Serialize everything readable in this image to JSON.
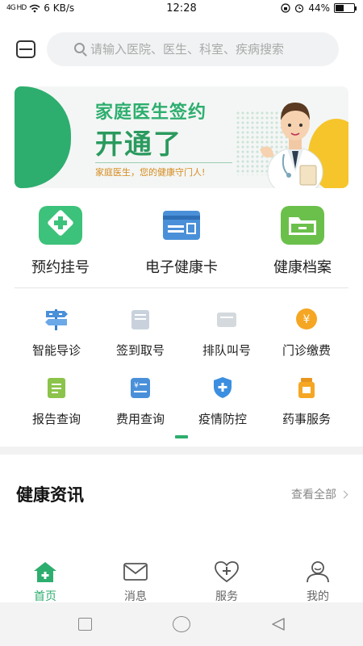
{
  "status": {
    "signal": "4G HD",
    "speed": "6 KB/s",
    "time": "12:28",
    "battery_text": "44%",
    "battery_level": 0.44
  },
  "search": {
    "placeholder": "请输入医院、医生、科室、疾病搜索"
  },
  "banner": {
    "line1": "家庭医生签约",
    "line2": "开通了",
    "line3": "家庭医生，您的健康守门人!"
  },
  "main_services": [
    {
      "label": "预约挂号",
      "icon": "plus-card-icon",
      "color": "#3cc27a"
    },
    {
      "label": "电子健康卡",
      "icon": "health-card-icon",
      "color": "#4a90d9"
    },
    {
      "label": "健康档案",
      "icon": "folder-icon",
      "color": "#6bc04b"
    }
  ],
  "quick_services": [
    {
      "label": "智能导诊",
      "icon": "signpost-icon"
    },
    {
      "label": "签到取号",
      "icon": "checkin-icon"
    },
    {
      "label": "排队叫号",
      "icon": "queue-icon"
    },
    {
      "label": "门诊缴费",
      "icon": "yuan-coin-icon"
    },
    {
      "label": "报告查询",
      "icon": "report-icon"
    },
    {
      "label": "费用查询",
      "icon": "bill-icon"
    },
    {
      "label": "疫情防控",
      "icon": "shield-icon"
    },
    {
      "label": "药事服务",
      "icon": "medicine-icon"
    }
  ],
  "news": {
    "title": "健康资讯",
    "view_all": "查看全部"
  },
  "tabs": [
    {
      "label": "首页",
      "icon": "home-icon",
      "active": true
    },
    {
      "label": "消息",
      "icon": "mail-icon",
      "active": false
    },
    {
      "label": "服务",
      "icon": "heart-plus-icon",
      "active": false
    },
    {
      "label": "我的",
      "icon": "user-icon",
      "active": false
    }
  ],
  "colors": {
    "accent": "#2dae6e",
    "banner_yellow": "#f5c52b"
  }
}
